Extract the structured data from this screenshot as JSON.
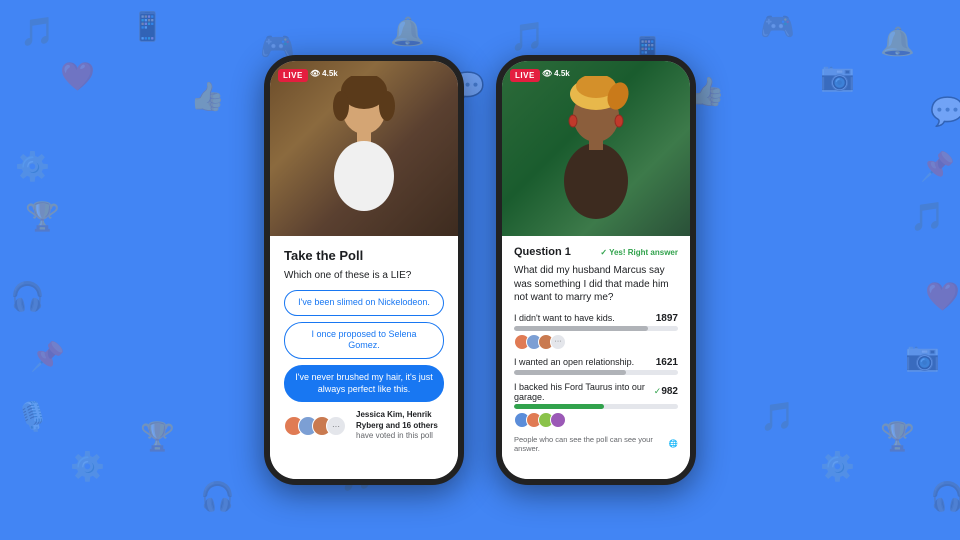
{
  "background": {
    "color": "#4285f4"
  },
  "phone1": {
    "live_label": "LIVE",
    "viewer_count": "4.5k",
    "poll": {
      "title": "Take the Poll",
      "question": "Which one of these is a LIE?",
      "options": [
        {
          "text": "I've been slimed on Nickelodeon.",
          "selected": false
        },
        {
          "text": "I once proposed to Selena Gomez.",
          "selected": false
        },
        {
          "text": "I've never brushed my hair, it's just always perfect like this.",
          "selected": true
        }
      ],
      "voters_text_bold": "Jessica Kim, Henrik Ryberg and 16 others",
      "voters_text_normal": "have voted in this poll"
    }
  },
  "phone2": {
    "live_label": "LIVE",
    "viewer_count": "4.5k",
    "results": {
      "question_label": "Question 1",
      "correct_label": "Yes! Right answer",
      "question_text": "What did my husband Marcus say was something I did that made him not want to marry me?",
      "answers": [
        {
          "text": "I didn't want to have kids.",
          "count": "1897",
          "bar_pct": 82,
          "correct": false,
          "show_avatars": true
        },
        {
          "text": "I wanted an open relationship.",
          "count": "1621",
          "bar_pct": 68,
          "correct": false,
          "show_avatars": false
        },
        {
          "text": "I backed his Ford Taurus into our garage.",
          "count": "982",
          "bar_pct": 55,
          "correct": true,
          "show_avatars": true
        }
      ],
      "footer_text": "People who can see the poll can see your answer."
    }
  }
}
